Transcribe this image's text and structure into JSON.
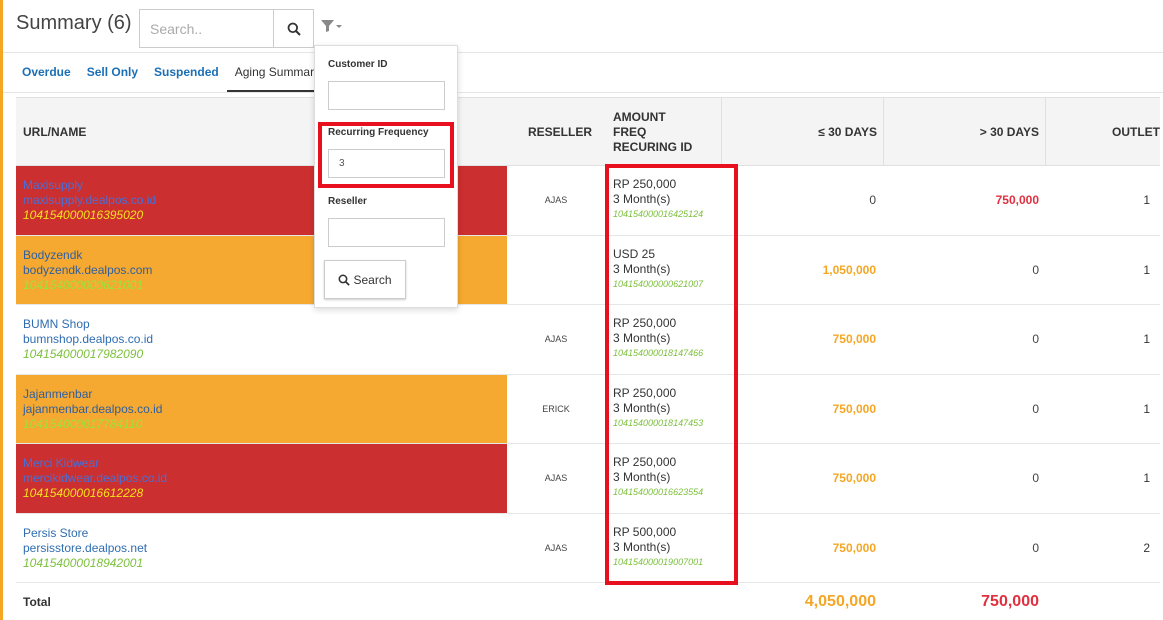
{
  "header": {
    "title": "Summary (6)",
    "search_placeholder": "Search.."
  },
  "tabs": [
    {
      "label": "Overdue",
      "active": false
    },
    {
      "label": "Sell Only",
      "active": false
    },
    {
      "label": "Suspended",
      "active": false
    },
    {
      "label": "Aging Summary",
      "active": true
    }
  ],
  "filter": {
    "customer_id_label": "Customer ID",
    "customer_id_value": "",
    "recurring_frequency_label": "Recurring Frequency",
    "recurring_frequency_value": "3",
    "reseller_label": "Reseller",
    "reseller_value": "",
    "search_button": "Search"
  },
  "table": {
    "columns": {
      "url_name": "URL/NAME",
      "reseller": "RESELLER",
      "amount_line1": "AMOUNT",
      "amount_line2": "FREQ",
      "amount_line3": "RECURING ID",
      "le30": "≤ 30 DAYS",
      "gt30": "> 30 DAYS",
      "outlet": "OUTLET"
    },
    "rows": [
      {
        "name": "Maxisupply",
        "url": "maxisupply.dealpos.co.id",
        "customer_id": "104154000016395020",
        "reseller": "AJAS",
        "amount": "RP 250,000",
        "freq": "3 Month(s)",
        "recurring_id": "104154000016425124",
        "le30": "0",
        "gt30": "750,000",
        "outlet": "1"
      },
      {
        "name": "Bodyzendk",
        "url": "bodyzendk.dealpos.com",
        "customer_id": "104154000000621001",
        "reseller": "",
        "amount": "USD 25",
        "freq": "3 Month(s)",
        "recurring_id": "104154000000621007",
        "le30": "1,050,000",
        "gt30": "0",
        "outlet": "1"
      },
      {
        "name": "BUMN Shop",
        "url": "bumnshop.dealpos.co.id",
        "customer_id": "104154000017982090",
        "reseller": "AJAS",
        "amount": "RP 250,000",
        "freq": "3 Month(s)",
        "recurring_id": "104154000018147466",
        "le30": "750,000",
        "gt30": "0",
        "outlet": "1"
      },
      {
        "name": "Jajanmenbar",
        "url": "jajanmenbar.dealpos.co.id",
        "customer_id": "104154000017784110",
        "reseller": "ERICK",
        "amount": "RP 250,000",
        "freq": "3 Month(s)",
        "recurring_id": "104154000018147453",
        "le30": "750,000",
        "gt30": "0",
        "outlet": "1"
      },
      {
        "name": "Merci Kidwear",
        "url": "mercikidwear.dealpos.co.id",
        "customer_id": "104154000016612228",
        "reseller": "AJAS",
        "amount": "RP 250,000",
        "freq": "3 Month(s)",
        "recurring_id": "104154000016623554",
        "le30": "750,000",
        "gt30": "0",
        "outlet": "1"
      },
      {
        "name": "Persis Store",
        "url": "persisstore.dealpos.net",
        "customer_id": "104154000018942001",
        "reseller": "AJAS",
        "amount": "RP 500,000",
        "freq": "3 Month(s)",
        "recurring_id": "104154000019007001",
        "le30": "750,000",
        "gt30": "0",
        "outlet": "2"
      }
    ],
    "total": {
      "label": "Total",
      "le30": "4,050,000",
      "gt30": "750,000"
    }
  },
  "colors": {
    "accent": "#f5a623",
    "overdue_row": "#cc2f2f",
    "warning_row": "#f5a930",
    "highlight": "#e80f1e",
    "link": "#1b6fb5",
    "recurring_id": "#7cc03c"
  },
  "icons": [
    "search-icon",
    "filter-icon"
  ]
}
